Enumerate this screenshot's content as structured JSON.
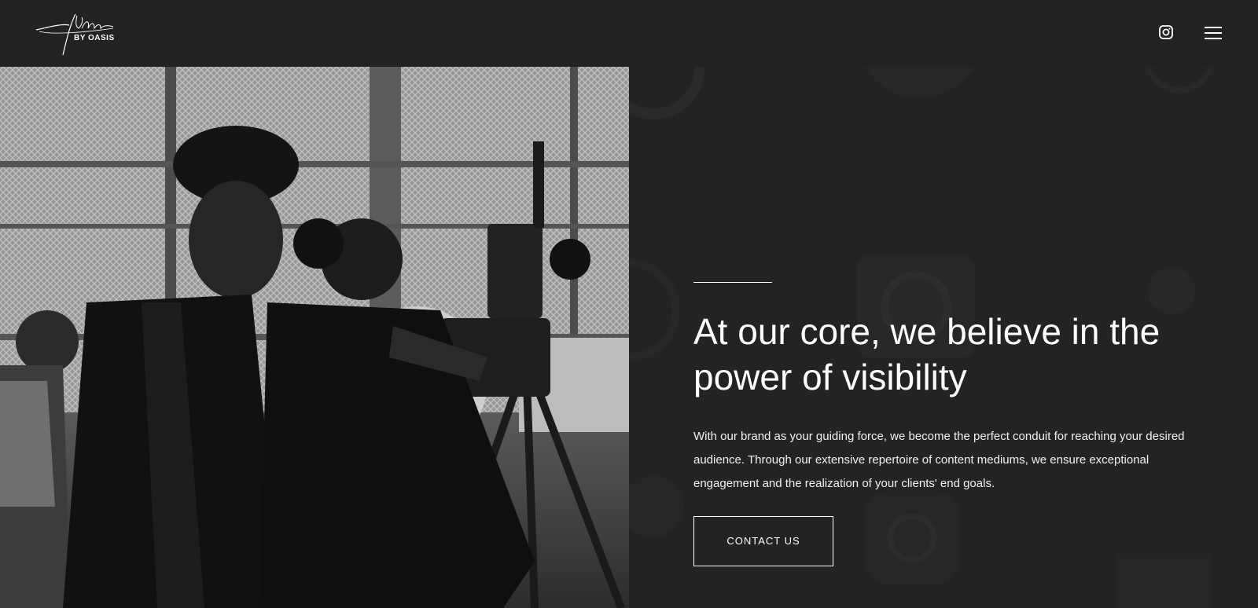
{
  "brand": {
    "logo_script": "Filmm",
    "logo_small": "BY OASIS"
  },
  "header": {
    "instagram_icon": "instagram-icon",
    "menu_icon": "hamburger-menu-icon"
  },
  "hero": {
    "headline": "At our core, we believe in the power of visibility",
    "body": "With our brand as your guiding force, we become the perfect conduit for reaching your desired audience. Through our extensive repertoire of content mediums, we ensure exceptional engagement and the realization of your clients' end goals.",
    "cta_label": "CONTACT US"
  },
  "colors": {
    "background": "#232323",
    "header": "#222222",
    "text": "#ffffff"
  }
}
